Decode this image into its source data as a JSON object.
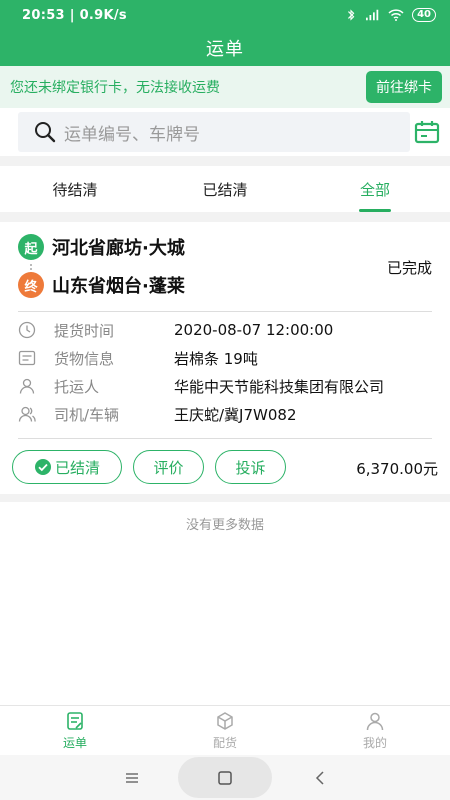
{
  "status_bar": {
    "left": "20:53 | 0.9K/s",
    "battery": "40"
  },
  "header": {
    "title": "运单"
  },
  "notice": {
    "text": "您还未绑定银行卡，无法接收运费",
    "button": "前往绑卡"
  },
  "search": {
    "placeholder": "运单编号、车牌号"
  },
  "tabs": [
    {
      "label": "待结清",
      "active": false
    },
    {
      "label": "已结清",
      "active": false
    },
    {
      "label": "全部",
      "active": true
    }
  ],
  "order": {
    "start_badge": "起",
    "start_place": "河北省廊坊·大城",
    "end_badge": "终",
    "end_place": "山东省烟台·蓬莱",
    "status": "已完成",
    "rows": [
      {
        "label": "提货时间",
        "value": "2020-08-07 12:00:00",
        "icon": "clock-icon"
      },
      {
        "label": "货物信息",
        "value": "岩棉条 19吨",
        "icon": "cargo-list-icon"
      },
      {
        "label": "托运人",
        "value": "华能中天节能科技集团有限公司",
        "icon": "person-icon"
      },
      {
        "label": "司机/车辆",
        "value": "王庆蛇/冀J7W082",
        "icon": "driver-icon"
      }
    ],
    "settled_label": "已结清",
    "rate_label": "评价",
    "complain_label": "投诉",
    "amount": "6,370.00元"
  },
  "list_footer": "没有更多数据",
  "bottom_nav": [
    {
      "label": "运单",
      "active": true,
      "icon": "waybill-icon"
    },
    {
      "label": "配货",
      "active": false,
      "icon": "box-icon"
    },
    {
      "label": "我的",
      "active": false,
      "icon": "user-icon"
    }
  ],
  "colors": {
    "primary": "#2db368",
    "end_badge": "#ee7a3a",
    "notice_bg": "#eaf6ef"
  }
}
